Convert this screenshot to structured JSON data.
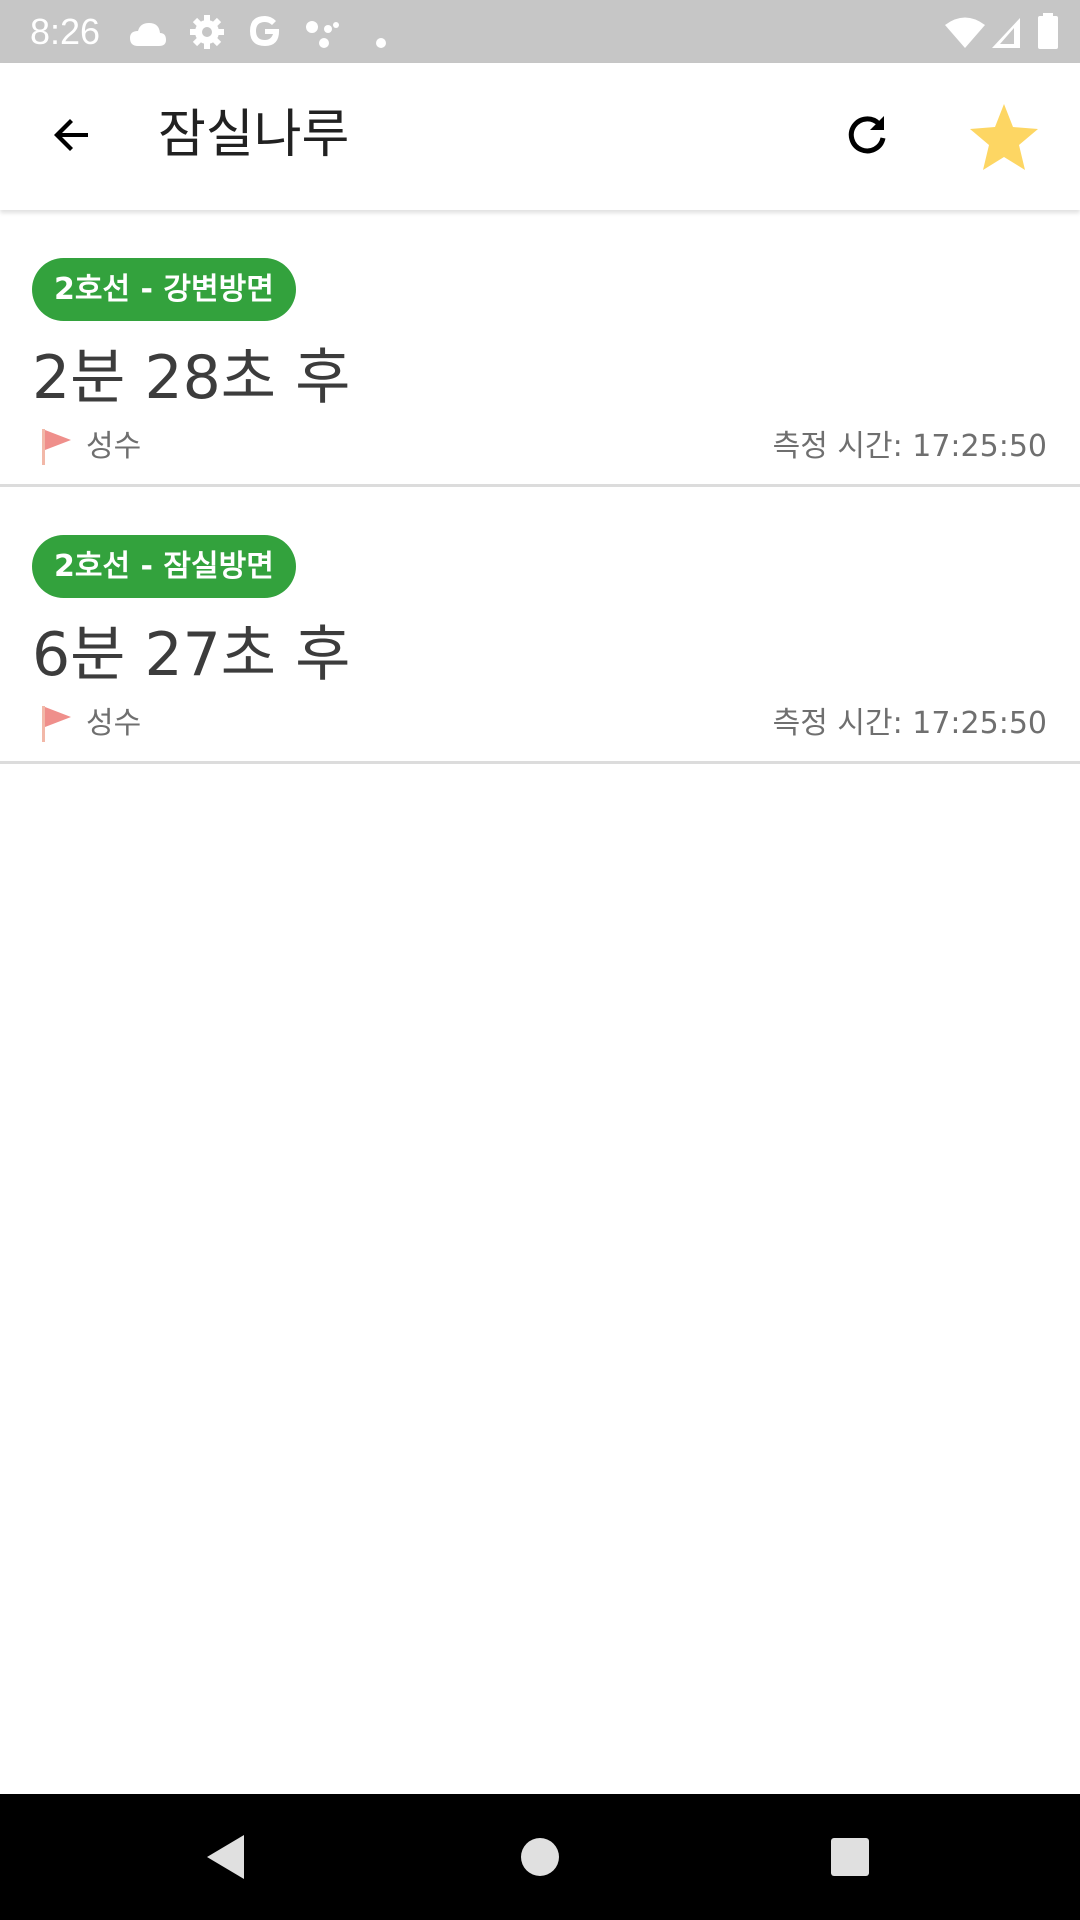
{
  "status_bar": {
    "time": "8:26",
    "left_icons": [
      "cloud-icon",
      "settings-icon",
      "google-icon",
      "assistant-dots-icon",
      "notification-dot-icon"
    ],
    "right_icons": [
      "wifi-icon",
      "cell-signal-icon",
      "battery-icon"
    ]
  },
  "app_bar": {
    "title": "잠실나루",
    "back_icon": "arrow-back-icon",
    "refresh_icon": "refresh-icon",
    "favorite_icon": "star-icon",
    "favorite_color": "#fdd663"
  },
  "arrivals": [
    {
      "line": "2호선 - 강변방면",
      "line_color": "#33a23d",
      "arrival": "2분 28초 후",
      "destination": "성수",
      "measured": "측정 시간: 17:25:50"
    },
    {
      "line": "2호선 - 잠실방면",
      "line_color": "#33a23d",
      "arrival": "6분 27초 후",
      "destination": "성수",
      "measured": "측정 시간: 17:25:50"
    }
  ],
  "nav_bar": {
    "buttons": [
      "back-triangle-icon",
      "home-circle-icon",
      "recents-square-icon"
    ]
  }
}
